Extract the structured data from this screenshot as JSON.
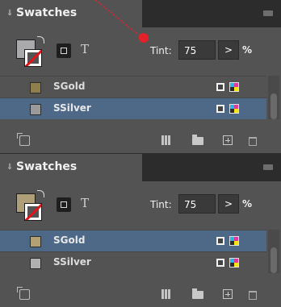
{
  "panels": [
    {
      "title": "Swatches",
      "tint_label": "Tint:",
      "tint_value": "75",
      "tint_stepper": ">",
      "tint_unit": "%",
      "fill_color": "#a9a9ab",
      "text_toggle": "T",
      "swatches": [
        {
          "name": "SGold",
          "color": "#8e7f4d",
          "selected": false
        },
        {
          "name": "SSilver",
          "color": "#9a9a9a",
          "selected": true
        }
      ]
    },
    {
      "title": "Swatches",
      "tint_label": "Tint:",
      "tint_value": "75",
      "tint_stepper": ">",
      "tint_unit": "%",
      "fill_color": "#ae9f78",
      "text_toggle": "T",
      "swatches": [
        {
          "name": "SGold",
          "color": "#b4a173",
          "selected": true
        },
        {
          "name": "SSilver",
          "color": "#b0b0b0",
          "selected": false
        }
      ]
    }
  ],
  "colors": {
    "panel_bg": "#535353",
    "tab_bar_bg": "#2c2c2c",
    "selected_row": "#4d6987",
    "annotation_red": "#e4212b"
  },
  "icons": {
    "collapse": "chevron-icon",
    "panel_menu": "panel-menu-icon",
    "show_all": "show-all-swatches-icon",
    "swatch_view": "swatch-view-icon",
    "folder": "new-color-group-icon",
    "new_swatch": "new-swatch-icon",
    "delete": "trash-icon",
    "spot_type": "spot-color-type-icon",
    "color_mode": "cmyk-mode-icon"
  }
}
